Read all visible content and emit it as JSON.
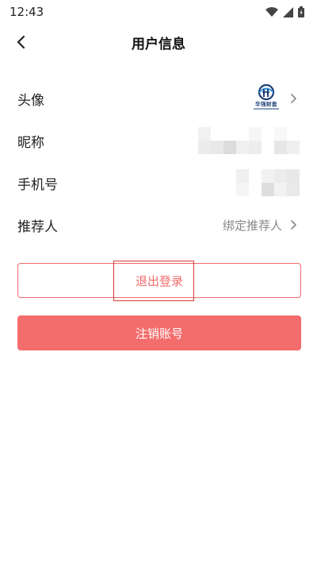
{
  "status_bar": {
    "time": "12:43"
  },
  "header": {
    "title": "用户信息"
  },
  "rows": {
    "avatar": {
      "label": "头像",
      "logo_text": "华强财盈"
    },
    "nickname": {
      "label": "昵称"
    },
    "phone": {
      "label": "手机号"
    },
    "referrer": {
      "label": "推荐人",
      "value": "绑定推荐人"
    }
  },
  "actions": {
    "logout_label": "退出登录",
    "cancel_account_label": "注销账号"
  },
  "colors": {
    "accent": "#f26b6b",
    "accent_fill": "#f46d6d",
    "highlight": "#d93a3a"
  }
}
